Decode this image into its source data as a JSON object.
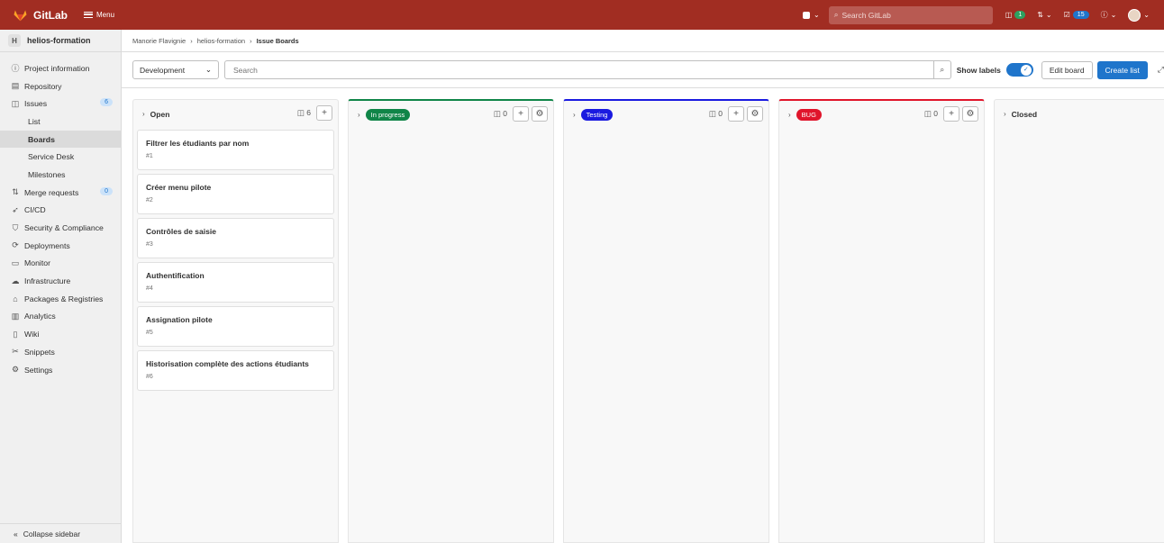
{
  "topbar": {
    "app_name": "GitLab",
    "menu_label": "Menu",
    "search_placeholder": "Search GitLab",
    "issues_count": "1",
    "todos_count": "15"
  },
  "sidebar": {
    "project_initial": "H",
    "project_name": "helios-formation",
    "items": [
      {
        "label": "Project information",
        "icon": "info-icon"
      },
      {
        "label": "Repository",
        "icon": "document-icon"
      },
      {
        "label": "Issues",
        "icon": "issues-icon",
        "count": "6"
      },
      {
        "label": "List"
      },
      {
        "label": "Boards"
      },
      {
        "label": "Service Desk"
      },
      {
        "label": "Milestones"
      },
      {
        "label": "Merge requests",
        "icon": "merge-request-icon",
        "count": "0"
      },
      {
        "label": "CI/CD",
        "icon": "rocket-icon"
      },
      {
        "label": "Security & Compliance",
        "icon": "shield-icon"
      },
      {
        "label": "Deployments",
        "icon": "deploy-icon"
      },
      {
        "label": "Monitor",
        "icon": "monitor-icon"
      },
      {
        "label": "Infrastructure",
        "icon": "cloud-icon"
      },
      {
        "label": "Packages & Registries",
        "icon": "package-icon"
      },
      {
        "label": "Analytics",
        "icon": "chart-icon"
      },
      {
        "label": "Wiki",
        "icon": "book-icon"
      },
      {
        "label": "Snippets",
        "icon": "scissors-icon"
      },
      {
        "label": "Settings",
        "icon": "gear-icon"
      }
    ],
    "collapse_label": "Collapse sidebar"
  },
  "breadcrumb": {
    "items": [
      "Manorie Flavignie",
      "helios-formation",
      "Issue Boards"
    ]
  },
  "filter": {
    "board_name": "Development",
    "search_placeholder": "Search",
    "show_labels": "Show labels",
    "edit_board": "Edit board",
    "create_list": "Create list"
  },
  "lists": {
    "open": {
      "title": "Open",
      "count": "6"
    },
    "in_progress": {
      "title": "In progress",
      "count": "0",
      "color": "#108548"
    },
    "testing": {
      "title": "Testing",
      "count": "0",
      "color": "#1a1ae0"
    },
    "bug": {
      "title": "BUG",
      "count": "0",
      "color": "#e0152b"
    },
    "closed": {
      "title": "Closed"
    }
  },
  "cards": [
    {
      "title": "Filtrer les étudiants par nom",
      "number": "#1"
    },
    {
      "title": "Créer menu pilote",
      "number": "#2"
    },
    {
      "title": "Contrôles de saisie",
      "number": "#3"
    },
    {
      "title": "Authentification",
      "number": "#4"
    },
    {
      "title": "Assignation pilote",
      "number": "#5"
    },
    {
      "title": "Historisation complète des actions étudiants",
      "number": "#6"
    }
  ]
}
